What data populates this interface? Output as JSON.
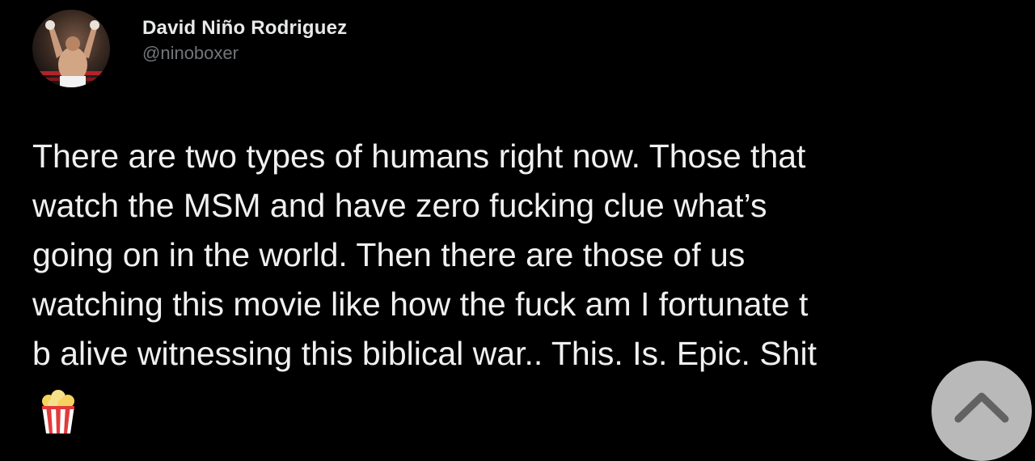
{
  "tweet": {
    "author": {
      "display_name": "David Niño Rodriguez",
      "handle": "@ninoboxer",
      "avatar_icon": "boxer-avatar"
    },
    "text_lines": [
      "There are two types of humans right now. Those that",
      "watch the MSM and have zero fucking clue what’s",
      "going on in the world. Then there are those of us",
      "watching this movie like how the fuck am I fortunate t",
      "b alive witnessing this biblical war.. This. Is. Epic. Shit"
    ],
    "emoji": "popcorn-icon"
  },
  "overlay": {
    "scroll_top_icon": "chevron-up-icon"
  },
  "colors": {
    "background": "#000000",
    "text": "#e7e9ea",
    "handle": "#71767b",
    "scroll_button": "#c9c9c9"
  }
}
